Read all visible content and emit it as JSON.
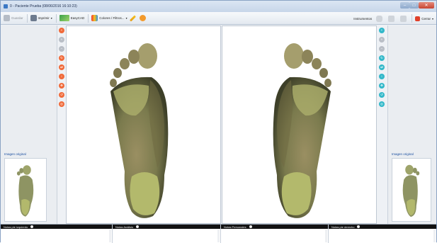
{
  "window": {
    "title": "0 - Paciente Prueba (08/06/2016 16:10:23)"
  },
  "toolbar": {
    "guardar": "Guardar",
    "imprimir": "Imprimir",
    "easycad": "EasyCAD",
    "colores": "Colores / Filtros...",
    "instrumentos": "Instrumentos",
    "cerrar": "Cerrar"
  },
  "left_panel": {
    "label": "Imagen original"
  },
  "right_panel": {
    "label": "Imagen original"
  },
  "notes": [
    {
      "label": "Notas pie izquierdo"
    },
    {
      "label": "Notas Análisis"
    },
    {
      "label": "Notas Personales"
    },
    {
      "label": "Notas pie derecho"
    }
  ],
  "colors": {
    "accent_orange": "#f06a3a",
    "accent_teal": "#32b8c9",
    "foot_fill": "#a7ad6a",
    "notes_header": "#121212"
  }
}
